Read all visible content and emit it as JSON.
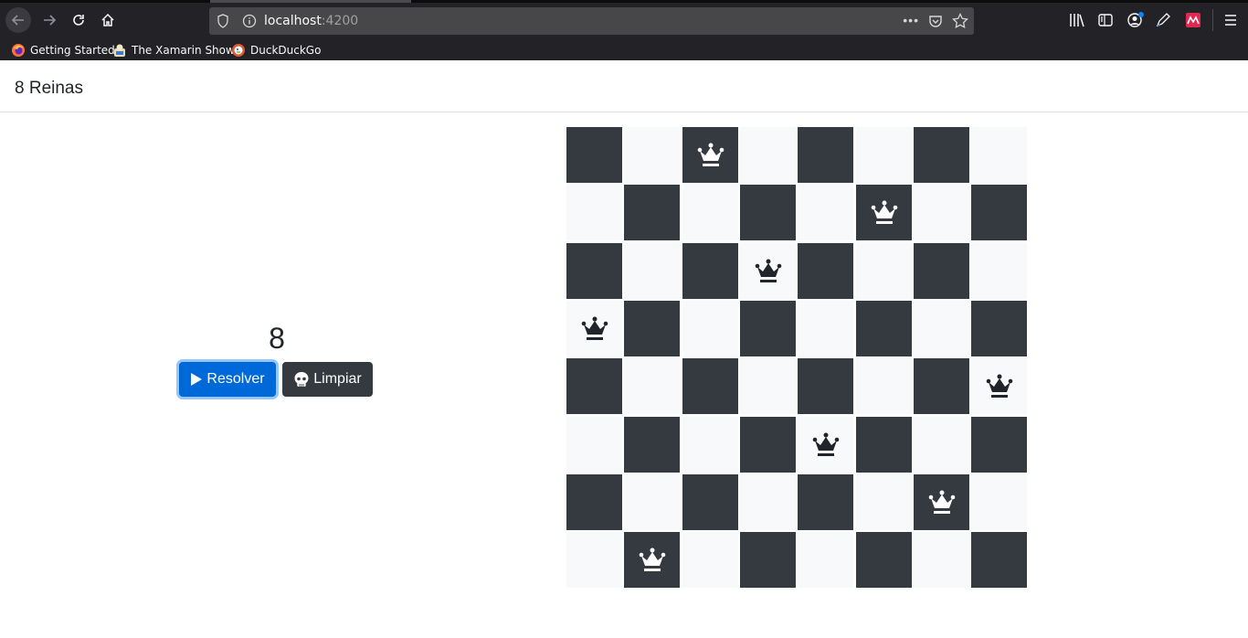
{
  "browser": {
    "url_host": "localhost",
    "url_port": ":4200",
    "bookmarks": [
      {
        "label": "Getting Started",
        "icon": "firefox-icon"
      },
      {
        "label": "The Xamarin Show",
        "icon": "xamarin-icon"
      },
      {
        "label": "DuckDuckGo",
        "icon": "duckduckgo-icon"
      }
    ]
  },
  "page": {
    "title": "8 Reinas",
    "count": "8",
    "solve_label": "Resolver",
    "clear_label": "Limpiar"
  },
  "board": {
    "size": 8,
    "queens_by_row": [
      2,
      5,
      3,
      0,
      7,
      4,
      6,
      1
    ]
  },
  "colors": {
    "dark_square": "#343a40",
    "light_square": "#f8f9fa",
    "primary": "#0069d9"
  }
}
